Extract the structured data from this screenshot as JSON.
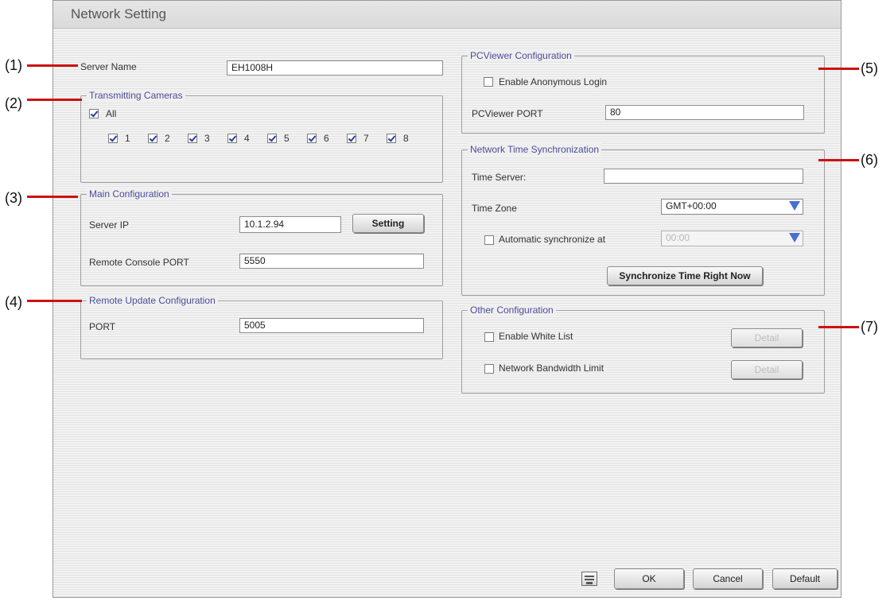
{
  "window": {
    "title": "Network Setting"
  },
  "callouts": [
    "(1)",
    "(2)",
    "(3)",
    "(4)",
    "(5)",
    "(6)",
    "(7)"
  ],
  "server": {
    "label": "Server Name",
    "value": "EH1008H"
  },
  "cameras": {
    "legend": "Transmitting Cameras",
    "all_label": "All",
    "all_checked": true,
    "items": [
      {
        "label": "1",
        "checked": true
      },
      {
        "label": "2",
        "checked": true
      },
      {
        "label": "3",
        "checked": true
      },
      {
        "label": "4",
        "checked": true
      },
      {
        "label": "5",
        "checked": true
      },
      {
        "label": "6",
        "checked": true
      },
      {
        "label": "7",
        "checked": true
      },
      {
        "label": "8",
        "checked": true
      }
    ]
  },
  "main_config": {
    "legend": "Main Configuration",
    "server_ip_label": "Server IP",
    "server_ip_value": "10.1.2.94",
    "setting_button": "Setting",
    "console_port_label": "Remote Console PORT",
    "console_port_value": "5550"
  },
  "remote_update": {
    "legend": "Remote Update Configuration",
    "port_label": "PORT",
    "port_value": "5005"
  },
  "pcviewer": {
    "legend": "PCViewer Configuration",
    "anonymous_label": "Enable Anonymous Login",
    "anonymous_checked": false,
    "port_label": "PCViewer PORT",
    "port_value": "80"
  },
  "time_sync": {
    "legend": "Network Time Synchronization",
    "server_label": "Time Server:",
    "server_value": "",
    "zone_label": "Time Zone",
    "zone_value": "GMT+00:00",
    "auto_label": "Automatic synchronize at",
    "auto_checked": false,
    "auto_value": "00:00",
    "sync_button": "Synchronize Time Right Now"
  },
  "other_config": {
    "legend": "Other Configuration",
    "white_list_label": "Enable White List",
    "white_list_checked": false,
    "bandwidth_label": "Network Bandwidth Limit",
    "bandwidth_checked": false,
    "detail_button": "Detail"
  },
  "footer": {
    "ok": "OK",
    "cancel": "Cancel",
    "default": "Default",
    "keyboard_icon": "keyboard-icon"
  },
  "colors": {
    "callout_line": "#cc1111",
    "legend_text": "#4c4c9a",
    "combo_arrow": "#4a6fcf"
  }
}
